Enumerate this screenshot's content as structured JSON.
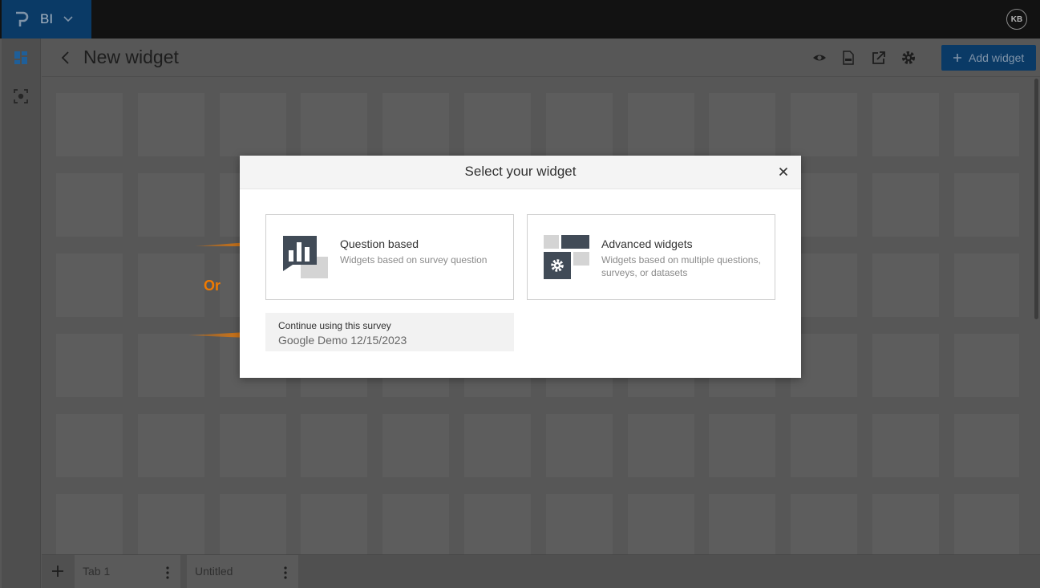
{
  "topbar": {
    "app_name": "BI",
    "avatar_initials": "KB"
  },
  "header": {
    "title": "New widget",
    "add_button_label": "Add widget"
  },
  "tabs": [
    {
      "label": "Tab 1"
    },
    {
      "label": "Untitled"
    }
  ],
  "modal": {
    "title": "Select your widget",
    "options": [
      {
        "title": "Question based",
        "description": "Widgets based on survey question"
      },
      {
        "title": "Advanced widgets",
        "description": "Widgets based on multiple questions, surveys, or datasets"
      }
    ],
    "continue": {
      "label": "Continue using this survey",
      "survey": "Google Demo 12/15/2023"
    }
  },
  "annotation": {
    "or_text": "Or"
  },
  "colors": {
    "brand": "#0a3a66",
    "annotation": "#f07a00",
    "icon_dark": "#414b57",
    "icon_light": "#d4d4d4"
  }
}
